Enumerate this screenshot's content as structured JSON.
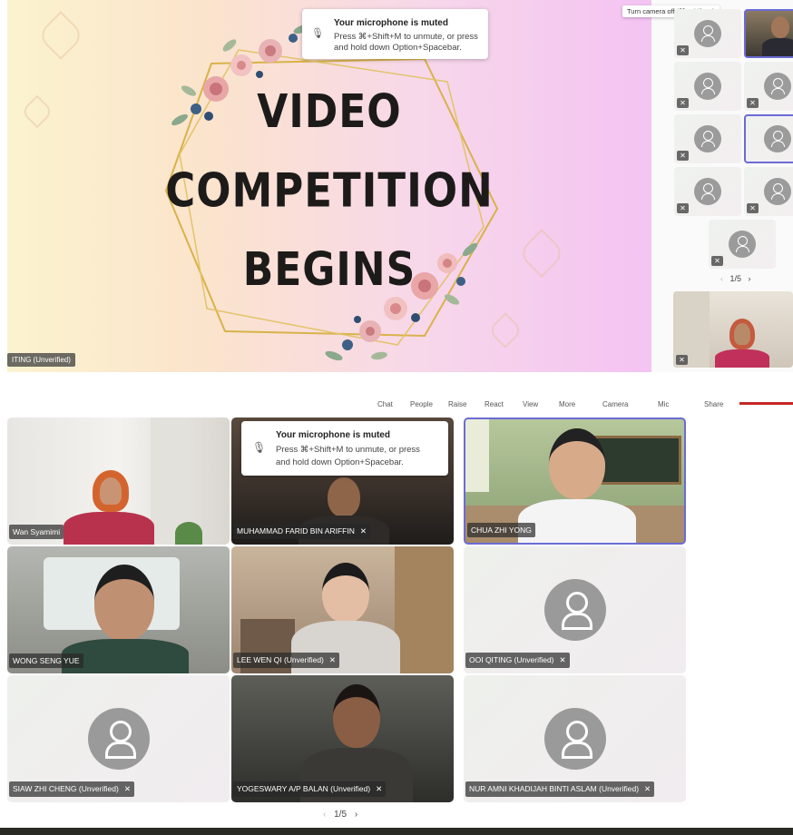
{
  "slide": {
    "line1": "VIDEO",
    "line2": "COMPETITION",
    "line3": "BEGINS",
    "speaker_tag": "ITING (Unverified)"
  },
  "toast_top": {
    "title": "Your microphone is muted",
    "body1": "Press ⌘+Shift+M to unmute, or press",
    "body2": "and hold down Option+Spacebar."
  },
  "camera_tooltip": "Turn camera off (⌘+Shift+O)",
  "sidebar_pager": "1/5",
  "toolbar": {
    "chat": "Chat",
    "people": "People",
    "raise": "Raise",
    "react": "React",
    "view": "View",
    "more": "More",
    "camera": "Camera",
    "mic": "Mic",
    "share": "Share"
  },
  "toast_bottom": {
    "title": "Your microphone is muted",
    "body1": "Press ⌘+Shift+M to unmute, or press",
    "body2": "and hold down Option+Spacebar."
  },
  "participants": [
    {
      "name": "Wan Syamimi",
      "muted": false
    },
    {
      "name": "MUHAMMAD FARID BIN ARIFFIN",
      "muted": true
    },
    {
      "name": "CHUA ZHI YONG",
      "muted": false
    },
    {
      "name": "WONG SENG YUE",
      "muted": false
    },
    {
      "name": "LEE WEN QI (Unverified)",
      "muted": true
    },
    {
      "name": "OOI QITING (Unverified)",
      "muted": true
    },
    {
      "name": "SIAW ZHI CHENG (Unverified)",
      "muted": true
    },
    {
      "name": "YOGESWARY A/P BALAN (Unverified)",
      "muted": true
    },
    {
      "name": "NUR AMNI KHADIJAH BINTI ASLAM (Unverified)",
      "muted": true
    }
  ],
  "grid_pager": "1/5",
  "pager_prev": "‹",
  "pager_next": "›",
  "mute_glyph": "✕",
  "colors": {
    "accent": "#6b6bd6",
    "share_bar": "#c62828"
  }
}
